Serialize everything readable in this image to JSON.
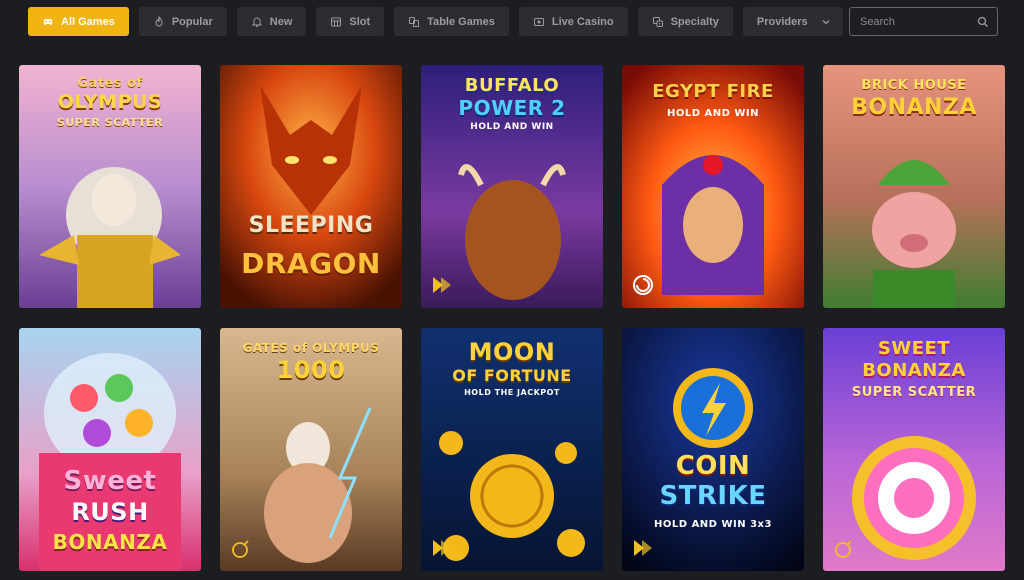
{
  "filters": [
    {
      "label": "All Games",
      "icon": "joystick-icon",
      "active": true
    },
    {
      "label": "Popular",
      "icon": "flame-icon",
      "active": false
    },
    {
      "label": "New",
      "icon": "bell-icon",
      "active": false
    },
    {
      "label": "Slot",
      "icon": "slot-machine-icon",
      "active": false
    },
    {
      "label": "Table Games",
      "icon": "cards-icon",
      "active": false
    },
    {
      "label": "Live Casino",
      "icon": "video-icon",
      "active": false
    },
    {
      "label": "Specialty",
      "icon": "dice-icon",
      "active": false
    }
  ],
  "providers": {
    "label": "Providers",
    "icon": "chevron-down-icon"
  },
  "search": {
    "placeholder": "Search",
    "icon": "search-icon"
  },
  "games": [
    {
      "title_lines": [
        "Gates of",
        "OLYMPUS",
        "SUPER SCATTER"
      ],
      "colors": [
        "#e9a6c9",
        "#7a4aa6"
      ],
      "provider_icon": "none"
    },
    {
      "title_lines": [
        "SLEEPING",
        "DRAGON",
        ""
      ],
      "colors": [
        "#f06a12",
        "#5a1604"
      ],
      "provider_icon": "none"
    },
    {
      "title_lines": [
        "BUFFALO",
        "POWER 2",
        "HOLD AND WIN"
      ],
      "colors": [
        "#3b2a8c",
        "#9b3f9e"
      ],
      "provider_icon": "triangle-provider-icon"
    },
    {
      "title_lines": [
        "EGYPT FIRE",
        "HOLD AND WIN",
        ""
      ],
      "colors": [
        "#ff7a10",
        "#a8160a"
      ],
      "provider_icon": "spiral-provider-icon"
    },
    {
      "title_lines": [
        "BRICK HOUSE",
        "BONANZA",
        ""
      ],
      "colors": [
        "#d67c6a",
        "#4c8a3a"
      ],
      "provider_icon": "none"
    },
    {
      "title_lines": [
        "Sweet",
        "RUSH",
        "BONANZA"
      ],
      "colors": [
        "#9fc8ea",
        "#e04b8f"
      ],
      "provider_icon": "none"
    },
    {
      "title_lines": [
        "GATES of OLYMPUS",
        "1000",
        ""
      ],
      "colors": [
        "#c9a77a",
        "#7a5a3a"
      ],
      "provider_icon": "bomb-provider-icon"
    },
    {
      "title_lines": [
        "MOON",
        "OF FORTUNE",
        "HOLD THE JACKPOT"
      ],
      "colors": [
        "#0f2a6a",
        "#081638"
      ],
      "provider_icon": "triangle-provider-icon"
    },
    {
      "title_lines": [
        "COIN",
        "STRIKE",
        "HOLD AND WIN 3x3"
      ],
      "colors": [
        "#0a1a5c",
        "#03081f"
      ],
      "provider_icon": "triangle-provider-icon"
    },
    {
      "title_lines": [
        "SWEET",
        "BONANZA",
        "SUPER SCATTER"
      ],
      "colors": [
        "#7a48d8",
        "#c65bd6"
      ],
      "provider_icon": "bomb-provider-icon"
    }
  ]
}
